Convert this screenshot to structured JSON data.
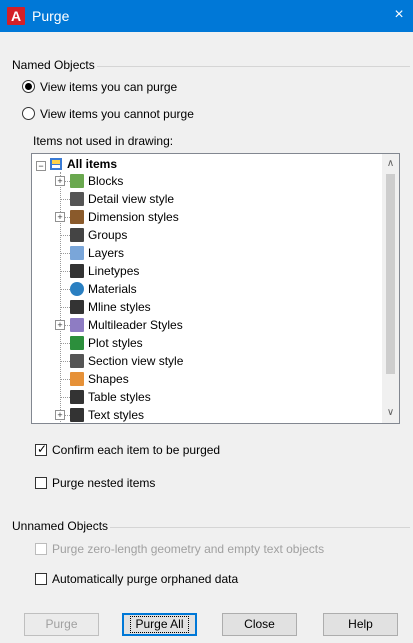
{
  "window": {
    "title": "Purge",
    "close_glyph": "×"
  },
  "named_objects": {
    "label": "Named Objects",
    "radio_can_purge": {
      "label": "View items you can purge",
      "selected": true
    },
    "radio_cannot_purge": {
      "label": "View items you cannot purge",
      "selected": false
    },
    "tree_label": "Items not used in drawing:",
    "tree": {
      "root": "All items",
      "items": [
        {
          "label": "Blocks",
          "expandable": true,
          "icon": "blocks-icon"
        },
        {
          "label": "Detail view style",
          "expandable": false,
          "icon": "detail-view-icon"
        },
        {
          "label": "Dimension styles",
          "expandable": true,
          "icon": "dimension-icon"
        },
        {
          "label": "Groups",
          "expandable": false,
          "icon": "groups-icon"
        },
        {
          "label": "Layers",
          "expandable": false,
          "icon": "layers-icon"
        },
        {
          "label": "Linetypes",
          "expandable": false,
          "icon": "linetypes-icon"
        },
        {
          "label": "Materials",
          "expandable": false,
          "icon": "materials-icon"
        },
        {
          "label": "Mline styles",
          "expandable": false,
          "icon": "mline-icon"
        },
        {
          "label": "Multileader Styles",
          "expandable": true,
          "icon": "multileader-icon"
        },
        {
          "label": "Plot styles",
          "expandable": false,
          "icon": "plot-styles-icon"
        },
        {
          "label": "Section view style",
          "expandable": false,
          "icon": "section-view-icon"
        },
        {
          "label": "Shapes",
          "expandable": false,
          "icon": "shapes-icon"
        },
        {
          "label": "Table styles",
          "expandable": false,
          "icon": "table-styles-icon"
        },
        {
          "label": "Text styles",
          "expandable": true,
          "icon": "text-styles-icon"
        }
      ]
    },
    "confirm_check": {
      "label": "Confirm each item to be purged",
      "checked": true
    },
    "nested_check": {
      "label": "Purge nested items",
      "checked": false
    }
  },
  "unnamed_objects": {
    "label": "Unnamed Objects",
    "zero_length": {
      "label": "Purge zero-length geometry and empty text objects",
      "checked": false,
      "enabled": false
    },
    "orphaned": {
      "label": "Automatically purge orphaned data",
      "checked": false
    }
  },
  "buttons": {
    "purge": "Purge",
    "purge_all": "Purge All",
    "close": "Close",
    "help": "Help"
  },
  "colors": {
    "titlebar": "#0078d7",
    "autocad_red": "#d42027"
  }
}
